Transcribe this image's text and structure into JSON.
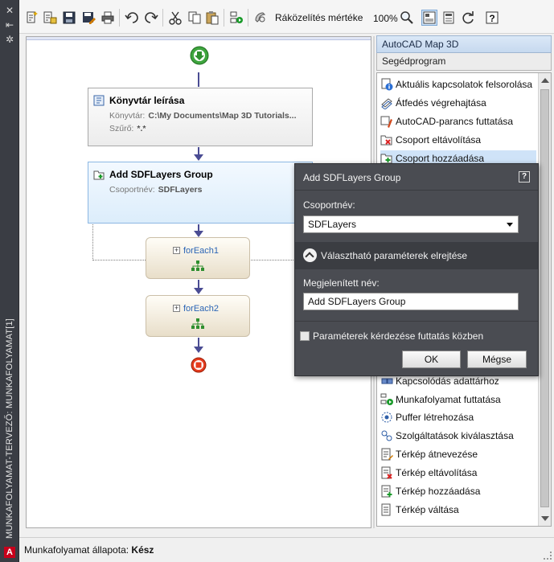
{
  "window": {
    "vertical_title": "MUNKAFOLYAMAT-TERVEZŐ: MUNKAFOLYAMAT[1]",
    "logo_letter": "A"
  },
  "toolbar": {
    "zoom_label": "Ráközelítés mértéke",
    "zoom_value": "100%",
    "icons": [
      "new-icon",
      "new-from-icon",
      "save-icon",
      "save-as-icon",
      "print-icon",
      "undo-icon",
      "redo-icon",
      "cut-icon",
      "copy-icon",
      "paste-icon",
      "run-icon",
      "zoom-tool-icon",
      "zoom-magnifier-icon",
      "toggle-view-icon",
      "properties-icon",
      "refresh-icon",
      "help-icon"
    ]
  },
  "canvas": {
    "library": {
      "title": "Könyvtár leírása",
      "row1_label": "Könyvtár:",
      "row1_value": "C:\\My Documents\\Map 3D Tutorials...",
      "row2_label": "Szűrő:",
      "row2_value": "*.*"
    },
    "group": {
      "title": "Add SDFLayers Group",
      "row1_label": "Csoportnév:",
      "row1_value": "SDFLayers"
    },
    "foreach1": "forEach1",
    "foreach2": "forEach2"
  },
  "right_panel": {
    "header": "AutoCAD Map 3D",
    "subheader": "Segédprogram",
    "items": [
      {
        "label": "Aktuális kapcsolatok felsorolása",
        "icon": "info-list-icon"
      },
      {
        "label": "Átfedés végrehajtása",
        "icon": "overlay-icon"
      },
      {
        "label": "AutoCAD-parancs futtatása",
        "icon": "autocad-command-icon"
      },
      {
        "label": "Csoport eltávolítása",
        "icon": "group-remove-icon"
      },
      {
        "label": "Csoport hozzáadása",
        "icon": "group-add-icon"
      },
      {
        "label": "Kapcsolódás adattárhoz",
        "icon": "connect-icon"
      },
      {
        "label": "Munkafolyamat futtatása",
        "icon": "run-workflow-icon"
      },
      {
        "label": "Puffer létrehozása",
        "icon": "buffer-icon"
      },
      {
        "label": "Szolgáltatások kiválasztása",
        "icon": "select-features-icon"
      },
      {
        "label": "Térkép átnevezése",
        "icon": "map-rename-icon"
      },
      {
        "label": "Térkép eltávolítása",
        "icon": "map-remove-icon"
      },
      {
        "label": "Térkép hozzáadása",
        "icon": "map-add-icon"
      },
      {
        "label": "Térkép váltása",
        "icon": "map-switch-icon"
      }
    ]
  },
  "dialog": {
    "title": "Add SDFLayers Group",
    "help": "?",
    "group_label": "Csoportnév:",
    "group_value": "SDFLayers",
    "section_label": "Választható paraméterek elrejtése",
    "name_label": "Megjelenített név:",
    "name_value": "Add SDFLayers Group",
    "check_label": "Paraméterek kérdezése futtatás közben",
    "ok": "OK",
    "cancel": "Mégse"
  },
  "status": {
    "label": "Munkafolyamat állapota:",
    "value": "Kész"
  }
}
